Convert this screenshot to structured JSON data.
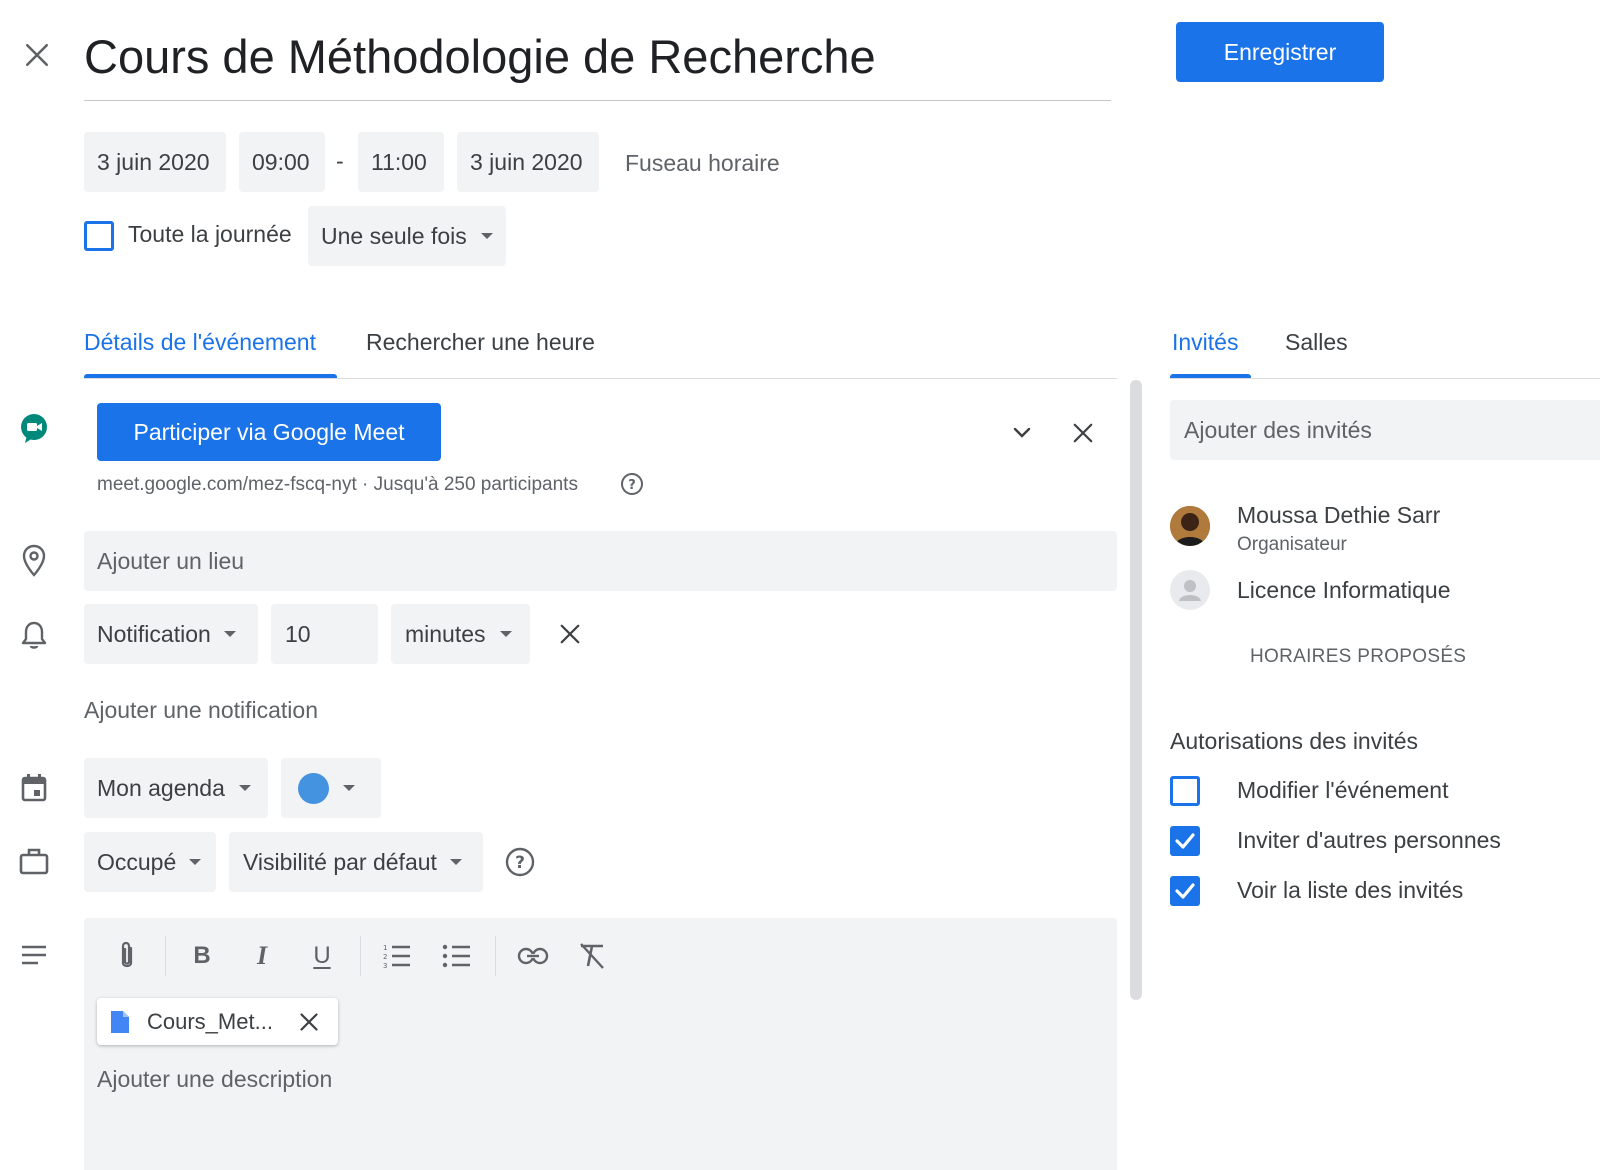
{
  "header": {
    "title": "Cours de Méthodologie de Recherche",
    "save_label": "Enregistrer"
  },
  "datetime": {
    "start_date": "3 juin 2020",
    "start_time": "09:00",
    "separator": "-",
    "end_time": "11:00",
    "end_date": "3 juin 2020",
    "timezone_label": "Fuseau horaire",
    "all_day_label": "Toute la journée",
    "all_day_checked": false,
    "recurrence": "Une seule fois"
  },
  "tabs_left": {
    "details": "Détails de l'événement",
    "find_time": "Rechercher une heure"
  },
  "meet": {
    "button_label": "Participer via Google Meet",
    "info": "meet.google.com/mez-fscq-nyt · Jusqu'à 250 participants"
  },
  "location": {
    "placeholder": "Ajouter un lieu"
  },
  "notification": {
    "type": "Notification",
    "value": "10",
    "unit": "minutes",
    "add_label": "Ajouter une notification"
  },
  "calendar": {
    "name": "Mon agenda",
    "color": "#4393e0"
  },
  "availability": {
    "status": "Occupé",
    "visibility": "Visibilité par défaut"
  },
  "description": {
    "attachment_name": "Cours_Met...",
    "placeholder": "Ajouter une description"
  },
  "tabs_right": {
    "guests": "Invités",
    "rooms": "Salles"
  },
  "guests": {
    "placeholder": "Ajouter des invités",
    "list": [
      {
        "name": "Moussa Dethie Sarr",
        "role": "Organisateur"
      },
      {
        "name": "Licence Informatique",
        "role": ""
      }
    ],
    "proposed_times": "HORAIRES PROPOSÉS"
  },
  "permissions": {
    "title": "Autorisations des invités",
    "items": [
      {
        "label": "Modifier l'événement",
        "checked": false
      },
      {
        "label": "Inviter d'autres personnes",
        "checked": true
      },
      {
        "label": "Voir la liste des invités",
        "checked": true
      }
    ]
  },
  "colors": {
    "accent": "#1a73e8",
    "chip_bg": "#f1f3f4",
    "text": "#3c4043",
    "muted": "#5f6368"
  }
}
